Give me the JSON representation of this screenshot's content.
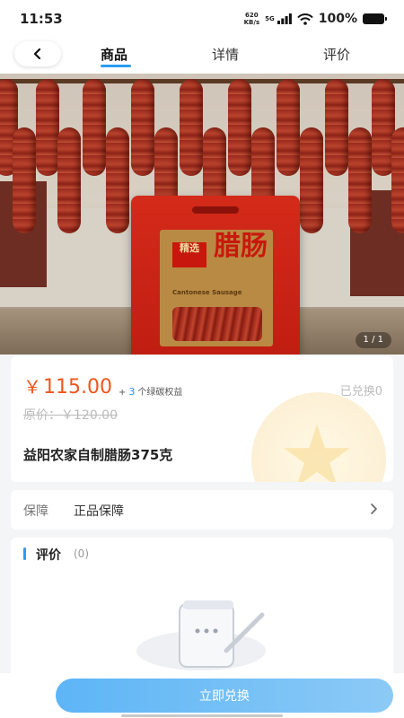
{
  "status_bar": {
    "time": "11:53",
    "net_speed_value": "620",
    "net_speed_unit": "KB/s",
    "signal": "5G",
    "battery": "100%"
  },
  "nav": {
    "tabs": [
      {
        "label": "商品",
        "active": true
      },
      {
        "label": "详情",
        "active": false
      },
      {
        "label": "评价",
        "active": false
      }
    ],
    "back_icon": "chevron-left-icon"
  },
  "hero": {
    "bag_title": "腊肠",
    "bag_sub": "精选",
    "bag_english": "Cantonese Sausage",
    "pager": "1 / 1"
  },
  "product": {
    "currency": "￥",
    "price": "115.00",
    "carbon_prefix": "+",
    "carbon_count": "3",
    "carbon_label": "个绿碳权益",
    "redeemed": "已兑换0",
    "original_price": "原价：￥120.00",
    "name": "益阳农家自制腊肠375克"
  },
  "guarantee": {
    "label": "保障",
    "value": "正品保障"
  },
  "reviews": {
    "title": "评价",
    "count": "(0)"
  },
  "actions": {
    "redeem_label": "立即兑换"
  },
  "colors": {
    "accent": "#2a9cf0",
    "price": "#f0561e",
    "button": "#6cbcf6"
  }
}
